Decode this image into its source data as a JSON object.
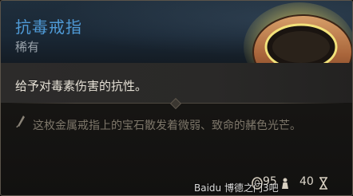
{
  "item": {
    "name": "抗毒戒指",
    "rarity": "稀有",
    "effect": "给予对毒素伤害的抗性。",
    "flavor": "这枚金属戒指上的宝石散发着微弱、致命的赭色光芒。"
  },
  "stats": {
    "price": "95",
    "weight": "40"
  },
  "icons": {
    "item_image": "ring-icon",
    "flavor_marker": "quill-icon",
    "price": "coin-icon",
    "weight": "weight-icon",
    "hourglass": "hourglass-icon"
  },
  "watermark": "Baidu 博德之门3吧",
  "colors": {
    "name": "#4f9ad6",
    "rarity": "#9aa3ab",
    "effect": "#e6e1d6",
    "flavor": "#7d7669"
  }
}
